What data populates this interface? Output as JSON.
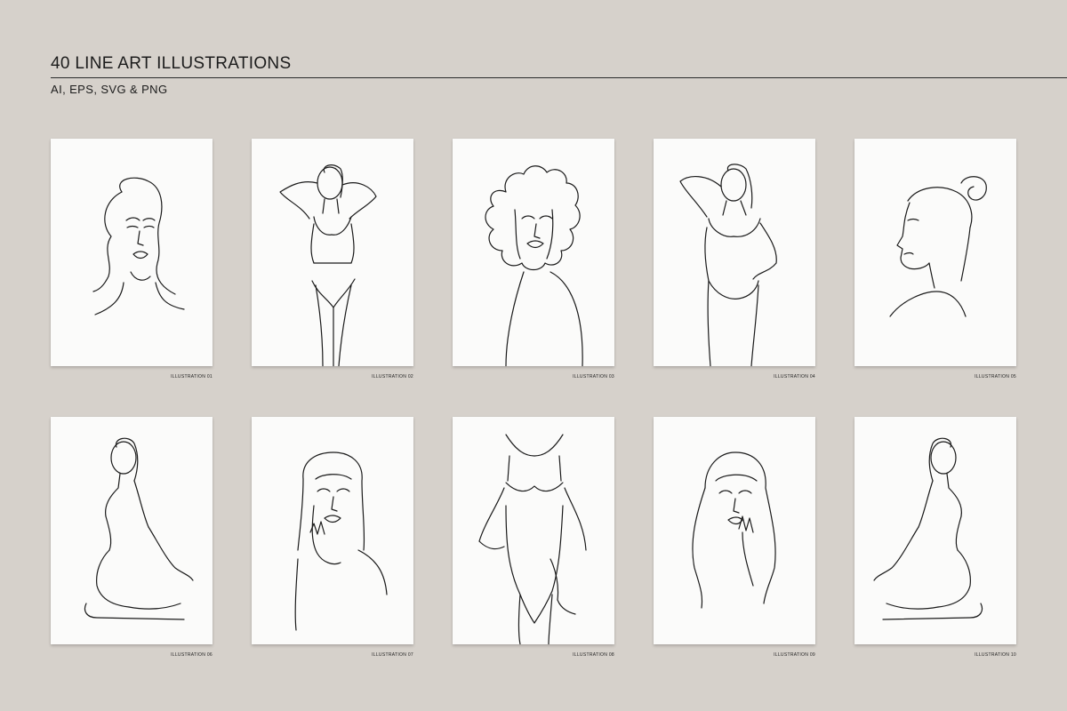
{
  "header": {
    "title": "40 LINE ART ILLUSTRATIONS",
    "subtitle": "AI, EPS, SVG & PNG"
  },
  "illustrations": [
    {
      "label": "ILLUSTRATION 01",
      "icon": "portrait-wavy-hair-icon"
    },
    {
      "label": "ILLUSTRATION 02",
      "icon": "standing-arms-up-icon"
    },
    {
      "label": "ILLUSTRATION 03",
      "icon": "curly-hair-portrait-icon"
    },
    {
      "label": "ILLUSTRATION 04",
      "icon": "standing-hand-on-hip-icon"
    },
    {
      "label": "ILLUSTRATION 05",
      "icon": "profile-hair-bun-icon"
    },
    {
      "label": "ILLUSTRATION 06",
      "icon": "kneeling-back-view-icon"
    },
    {
      "label": "ILLUSTRATION 07",
      "icon": "portrait-hand-on-chin-icon"
    },
    {
      "label": "ILLUSTRATION 08",
      "icon": "torso-bodysuit-icon"
    },
    {
      "label": "ILLUSTRATION 09",
      "icon": "long-hair-hand-on-lip-icon"
    },
    {
      "label": "ILLUSTRATION 10",
      "icon": "kneeling-back-view-mirrored-icon"
    }
  ],
  "colors": {
    "background": "#d6d1cb",
    "card": "#fbfbfa",
    "ink": "#1a1a1a"
  }
}
